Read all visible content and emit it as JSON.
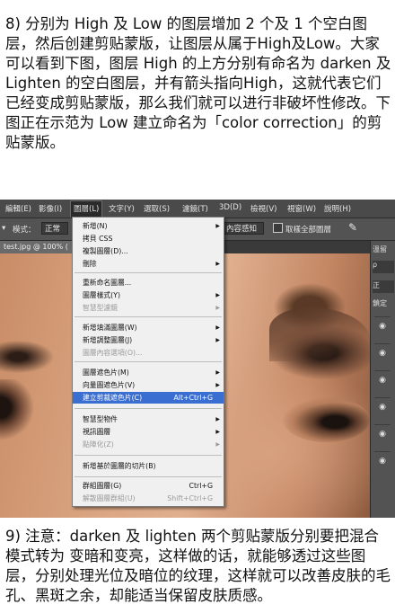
{
  "top_paragraph": "8) 分别为 High 及 Low 的图层增加 2 个及 1 个空白图层，然后创建剪贴蒙版，让图层从属于High及Low。大家可以看到下图，图层 High 的上方分别有命名为 darken 及 Lighten 的空白图层，并有箭头指向High，这就代表它们已经变成剪贴蒙版，那么我们就可以进行非破坏性修改。下图正在示范为 Low 建立命名为「color correction」的剪贴蒙版。",
  "bottom_paragraph": "9) 注意：darken 及 lighten 两个剪贴蒙版分别要把混合模式转为 变暗和变亮，这样做的话，就能够透过这些图层，分别处理光位及暗位的纹理，这样就可以改善皮肤的毛孔、黑斑之余，却能适当保留皮肤质感。",
  "menubar": [
    "編輯(E)",
    "影像(I)",
    "圖層(L)",
    "文字(Y)",
    "選取(S)",
    "濾鏡(T)",
    "3D(D)",
    "檢視(V)",
    "視窗(W)",
    "說明(H)"
  ],
  "options_bar": {
    "mode_label": "模式：",
    "mode_value": "正常",
    "content_aware": "內容感知",
    "sample_all": "取樣全部圖層"
  },
  "doc_tab": "test.jpg @ 100% (",
  "right_panel": {
    "top": "溫留",
    "search": "ρ",
    "mode": "正",
    "lock": "鎖定",
    "eye_icon": "◉"
  },
  "layer_menu": {
    "items": [
      {
        "label": "新增(N)",
        "shortcut": "",
        "submenu": true,
        "disabled": false
      },
      {
        "label": "拷貝 CSS",
        "shortcut": "",
        "submenu": false,
        "disabled": false
      },
      {
        "label": "複製圖層(D)...",
        "shortcut": "",
        "submenu": false,
        "disabled": false
      },
      {
        "label": "刪除",
        "shortcut": "",
        "submenu": true,
        "disabled": false
      },
      {
        "label": "重新命名圖層...",
        "shortcut": "",
        "submenu": false,
        "disabled": false
      },
      {
        "label": "圖層樣式(Y)",
        "shortcut": "",
        "submenu": true,
        "disabled": false
      },
      {
        "label": "智慧型濾鏡",
        "shortcut": "",
        "submenu": true,
        "disabled": true
      },
      {
        "label": "新增填滿圖層(W)",
        "shortcut": "",
        "submenu": true,
        "disabled": false
      },
      {
        "label": "新增調整圖層(J)",
        "shortcut": "",
        "submenu": true,
        "disabled": false
      },
      {
        "label": "圖層內容選項(O)...",
        "shortcut": "",
        "submenu": false,
        "disabled": true
      },
      {
        "label": "圖層遮色片(M)",
        "shortcut": "",
        "submenu": true,
        "disabled": false
      },
      {
        "label": "向量圖遮色片(V)",
        "shortcut": "",
        "submenu": true,
        "disabled": false
      },
      {
        "label": "建立剪裁遮色片(C)",
        "shortcut": "Alt+Ctrl+G",
        "submenu": false,
        "disabled": false,
        "highlighted": true
      },
      {
        "label": "智慧型物件",
        "shortcut": "",
        "submenu": true,
        "disabled": false
      },
      {
        "label": "視訊圖層",
        "shortcut": "",
        "submenu": true,
        "disabled": false
      },
      {
        "label": "點陣化(Z)",
        "shortcut": "",
        "submenu": true,
        "disabled": true
      },
      {
        "label": "新增基於圖層的切片(B)",
        "shortcut": "",
        "submenu": false,
        "disabled": false
      },
      {
        "label": "群組圖層(G)",
        "shortcut": "Ctrl+G",
        "submenu": false,
        "disabled": false
      },
      {
        "label": "解散圖層群組(U)",
        "shortcut": "Shift+Ctrl+G",
        "submenu": false,
        "disabled": true
      }
    ]
  }
}
